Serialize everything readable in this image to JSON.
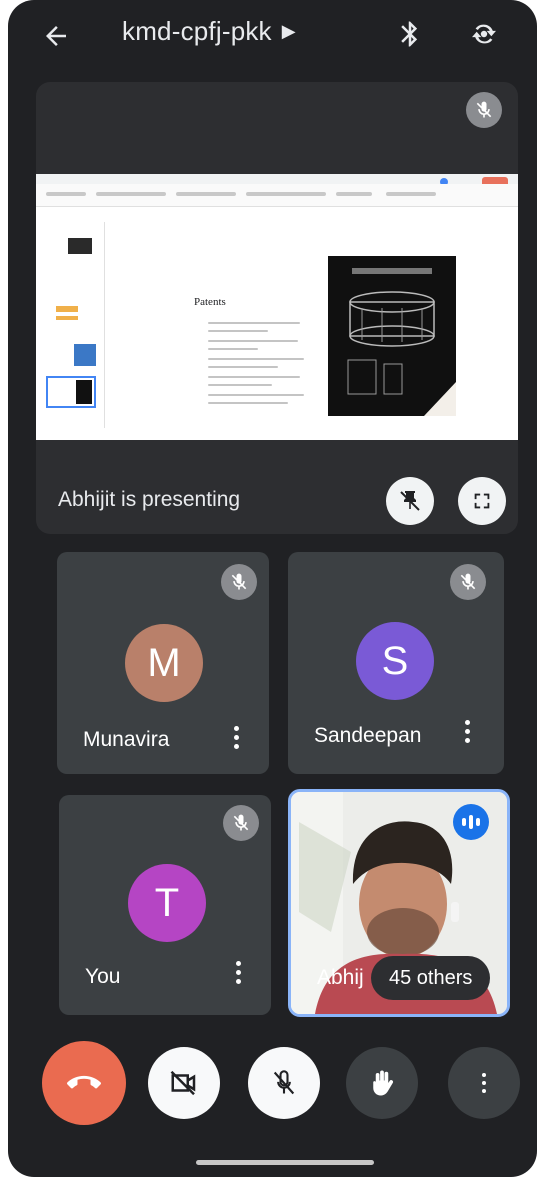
{
  "header": {
    "meeting_code": "kmd-cpfj-pkk",
    "icons": [
      "back-arrow-icon",
      "caret-right-icon",
      "bluetooth-icon",
      "switch-camera-icon"
    ]
  },
  "presentation": {
    "presenter_text": "Abhijit is presenting",
    "slide_title": "Patents",
    "icons": [
      "mic-off-icon",
      "pin-off-icon",
      "fullscreen-icon"
    ]
  },
  "participants": [
    {
      "name": "Munavira",
      "initial": "M",
      "avatar_color": "#b9806a",
      "muted": true
    },
    {
      "name": "Sandeepan",
      "initial": "S",
      "avatar_color": "#7a5ad6",
      "muted": true
    },
    {
      "name": "You",
      "initial": "T",
      "avatar_color": "#b545c4",
      "muted": true
    },
    {
      "name": "Abhij",
      "speaking": true
    }
  ],
  "others_pill": "45 others",
  "controls": {
    "icons": [
      "end-call-icon",
      "camera-off-icon",
      "mic-off-icon",
      "raise-hand-icon",
      "more-vert-icon"
    ],
    "end_call_color": "#ea6b50"
  }
}
